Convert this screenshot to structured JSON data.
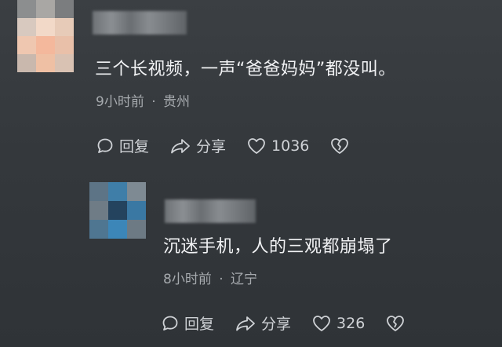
{
  "comment1": {
    "text": "三个长视频，一声“爸爸妈妈”都没叫。",
    "time": "9小时前",
    "location": "贵州",
    "reply_label": "回复",
    "share_label": "分享",
    "like_count": "1036"
  },
  "comment2": {
    "text": "沉迷手机，人的三观都崩塌了",
    "time": "8小时前",
    "location": "辽宁",
    "reply_label": "回复",
    "share_label": "分享",
    "like_count": "326"
  },
  "separator": "·",
  "colors": {
    "background": "#35393d",
    "text_primary": "#f1f2f4",
    "text_meta": "#a6aaae",
    "icon": "#cfd2d6"
  },
  "icons": [
    "reply-icon",
    "share-icon",
    "heart-icon",
    "broken-heart-icon"
  ]
}
